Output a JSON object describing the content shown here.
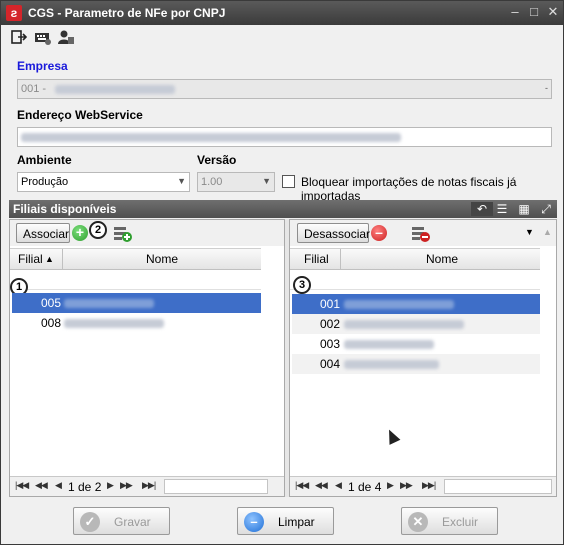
{
  "window": {
    "title": "CGS - Parametro de NFe por CNPJ",
    "controls": [
      "minimize",
      "maximize",
      "close"
    ]
  },
  "toolbar": {
    "icons": [
      "exit-icon",
      "keyboard-icon",
      "user-icon"
    ]
  },
  "form": {
    "empresa_label": "Empresa",
    "empresa_value": "001 -",
    "endereco_label": "Endereço WebService",
    "ambiente_label": "Ambiente",
    "ambiente_value": "Produção",
    "versao_label": "Versão",
    "versao_value": "1.00",
    "bloquear_label": "Bloquear importações de notas fiscais já importadas",
    "bloquear_checked": false
  },
  "panel": {
    "title": "Filiais disponíveis"
  },
  "left_pane": {
    "button_label": "Associar",
    "badge_top": "2",
    "badge_grid": "1",
    "columns": [
      "Filial",
      "Nome"
    ],
    "rows": [
      {
        "code": "005",
        "selected": true
      },
      {
        "code": "008",
        "selected": false
      }
    ],
    "pager": "1 de 2"
  },
  "right_pane": {
    "button_label": "Desassociar",
    "badge_grid": "3",
    "columns": [
      "Filial",
      "Nome"
    ],
    "rows": [
      {
        "code": "001",
        "selected": true
      },
      {
        "code": "002",
        "selected": false
      },
      {
        "code": "003",
        "selected": false
      },
      {
        "code": "004",
        "selected": false
      }
    ],
    "pager": "1 de 4"
  },
  "actions": {
    "gravar": "Gravar",
    "limpar": "Limpar",
    "excluir": "Excluir"
  }
}
